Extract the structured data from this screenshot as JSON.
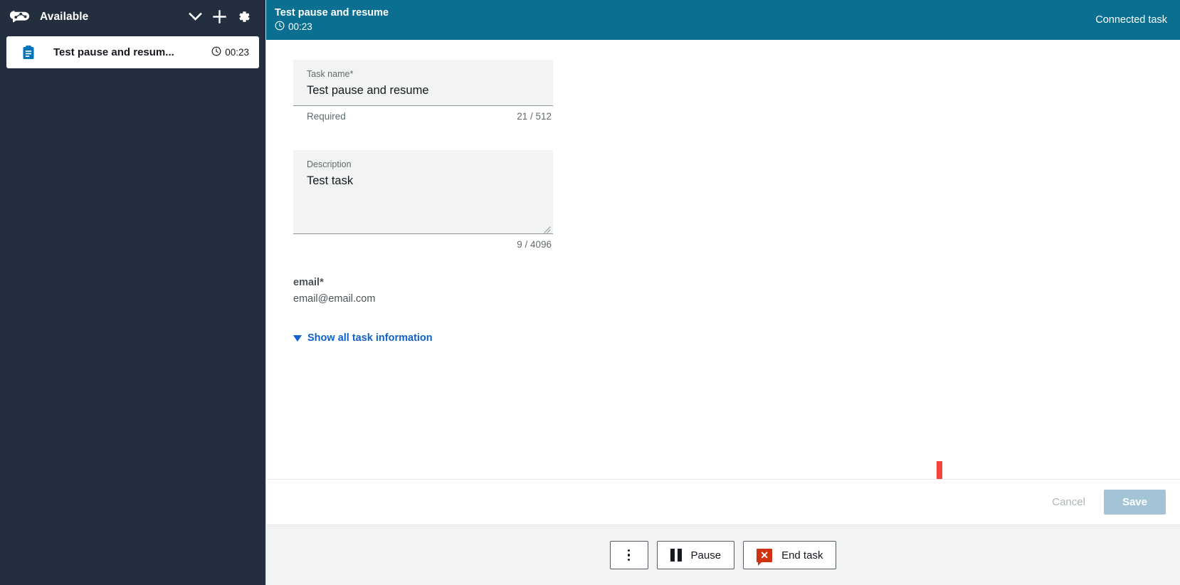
{
  "sidebar": {
    "logo_icon": "amazon-connect-cloud-icon",
    "agent_status": "Available",
    "status_chevron_icon": "chevron-down-icon",
    "add_icon": "plus-icon",
    "settings_icon": "gear-icon",
    "contacts": [
      {
        "icon": "task-clipboard-icon",
        "name": "Test pause and resum...",
        "timer_icon": "clock-icon",
        "timer": "00:23"
      }
    ]
  },
  "task_header": {
    "title": "Test pause and resume",
    "timer_icon": "clock-icon",
    "timer": "00:23",
    "connection_label": "Connected task",
    "background_color": "#0a6f90"
  },
  "form": {
    "task_name": {
      "label": "Task name*",
      "value": "Test pause and resume",
      "helper": "Required",
      "counter": "21 / 512"
    },
    "description": {
      "label": "Description",
      "value": "Test task",
      "counter": "9 / 4096"
    },
    "email": {
      "label": "email*",
      "value": "email@email.com"
    },
    "show_all_link": "Show all task information",
    "link_color": "#0d62ce",
    "caret_icon": "caret-down-icon"
  },
  "form_actions": {
    "cancel_label": "Cancel",
    "save_label": "Save",
    "save_color": "#a3c4d4"
  },
  "action_bar": {
    "more_icon": "vertical-ellipsis-icon",
    "pause_icon": "pause-icon",
    "pause_label": "Pause",
    "end_task_icon": "end-task-x-icon",
    "end_task_label": "End task"
  },
  "annotation": {
    "arrow_icon": "red-down-arrow-annotation",
    "color": "#f4433a"
  }
}
